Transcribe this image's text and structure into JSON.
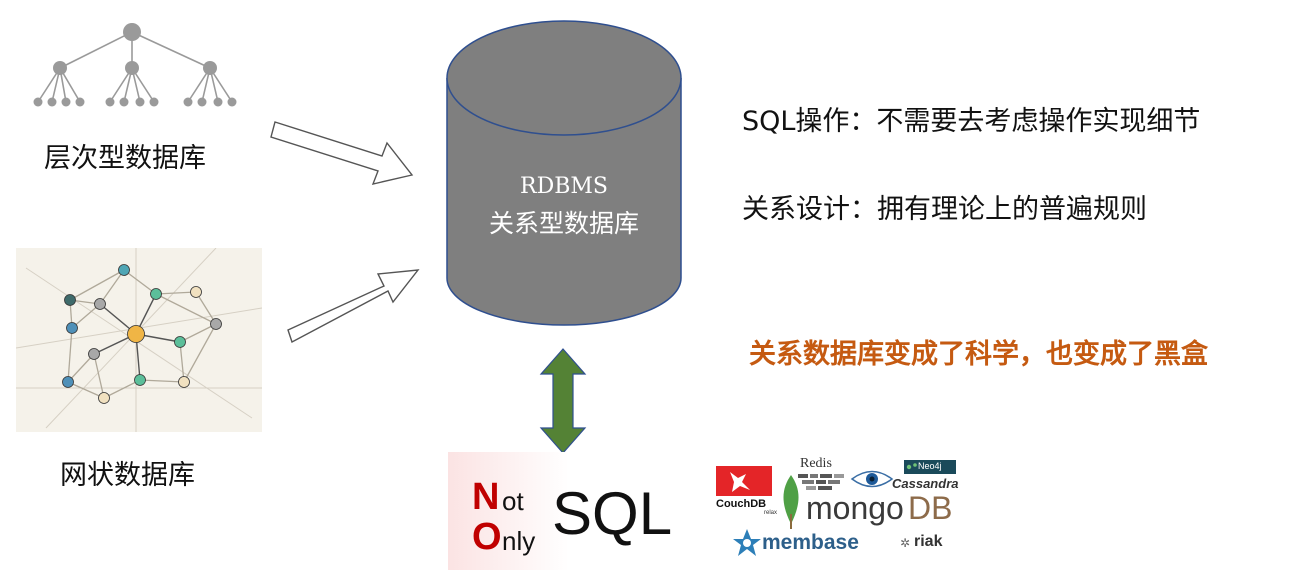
{
  "left": {
    "hierarchical_label": "层次型数据库",
    "network_label": "网状数据库"
  },
  "center": {
    "cylinder_line1": "RDBMS",
    "cylinder_line2": "关系型数据库"
  },
  "right": {
    "line1": "SQL操作：不需要去考虑操作实现细节",
    "line2": "关系设计：拥有理论上的普遍规则",
    "highlight": "关系数据库变成了科学，也变成了黑盒"
  },
  "nosql": {
    "n": "N",
    "o": "O",
    "ot": "ot",
    "nly": "nly",
    "sql": "SQL"
  },
  "logos": {
    "redis": "Redis",
    "neo4j": "Neo4j",
    "cassandra": "Cassandra",
    "couchdb": "CouchDB",
    "relax": "relax",
    "mongodb_mongo": "mongo",
    "mongodb_db": "DB",
    "membase": "membase",
    "riak": "riak"
  },
  "colors": {
    "cylinder_fill": "#7f7f7f",
    "cylinder_stroke": "#2f4f8f",
    "double_arrow": "#548235",
    "highlight": "#c55a11",
    "nosql_red": "#c00000"
  }
}
